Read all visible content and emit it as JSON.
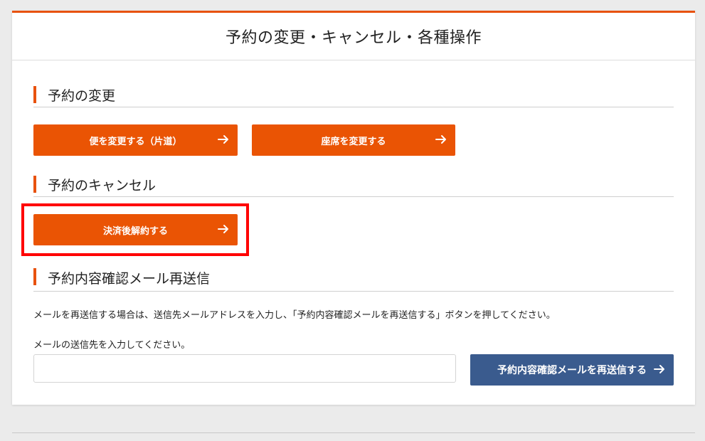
{
  "header": {
    "title": "予約の変更・キャンセル・各種操作"
  },
  "sections": {
    "change": {
      "heading": "予約の変更",
      "buttons": {
        "change_flight": "便を変更する（片道）",
        "change_seat": "座席を変更する"
      }
    },
    "cancel": {
      "heading": "予約のキャンセル",
      "buttons": {
        "cancel_after_payment": "決済後解約する"
      }
    },
    "resend": {
      "heading": "予約内容確認メール再送信",
      "description": "メールを再送信する場合は、送信先メールアドレスを入力し、「予約内容確認メールを再送信する」ボタンを押してください。",
      "input_label": "メールの送信先を入力してください。",
      "email_value": "",
      "button": "予約内容確認メールを再送信する"
    }
  },
  "colors": {
    "accent": "#e8520e",
    "primary_button": "#ea5404",
    "secondary_button": "#3a5b8e",
    "highlight": "#ff0000"
  }
}
